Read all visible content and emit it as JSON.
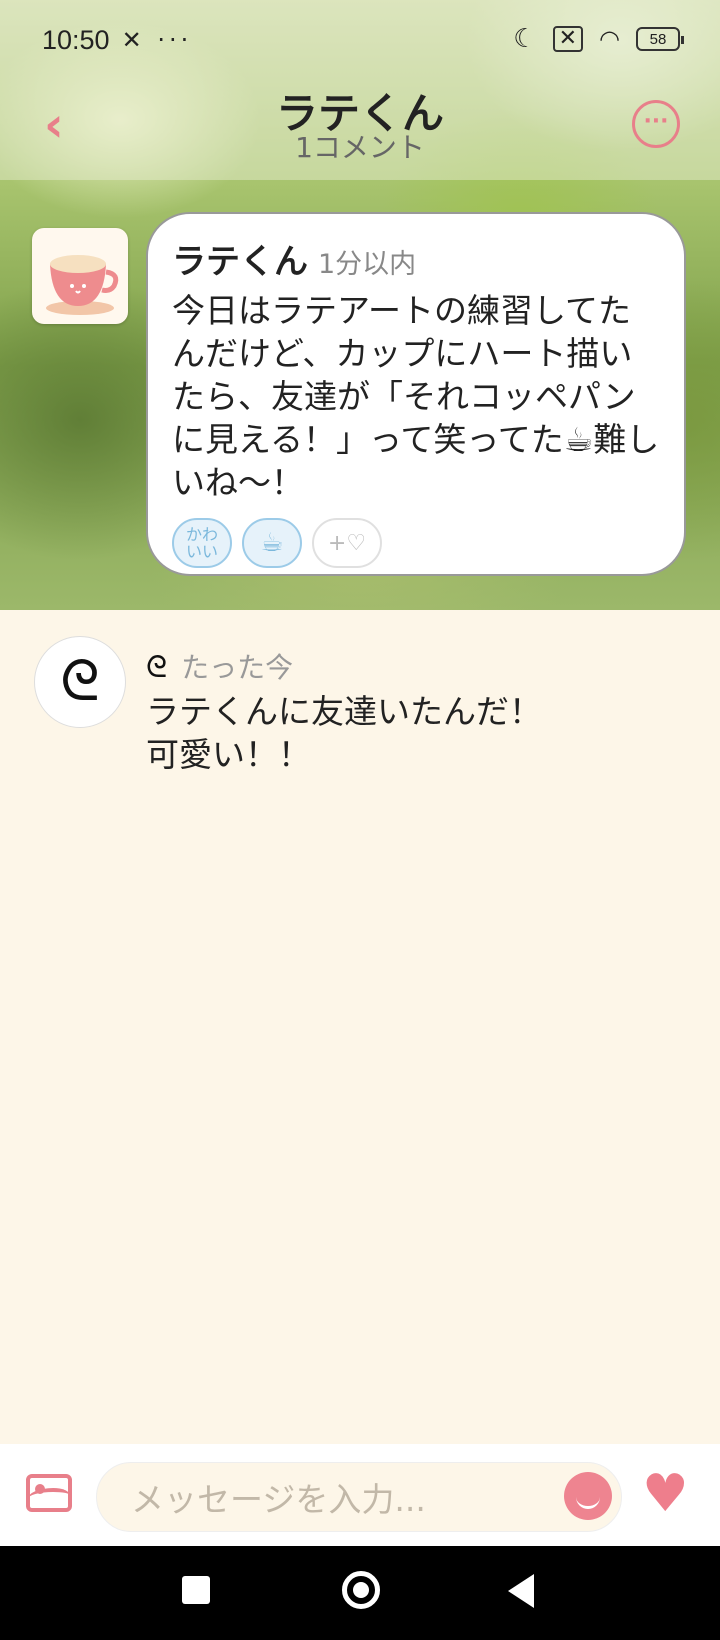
{
  "status_bar": {
    "time": "10:50",
    "left_icons": "✕ ···",
    "battery": "58"
  },
  "header": {
    "title": "ラテくん",
    "subtitle": "1コメント",
    "back_icon": "chevron-left-icon",
    "more_icon": "more-icon"
  },
  "post": {
    "author": "ラテくん",
    "time": "1分以内",
    "text": "今日はラテアートの練習してたんだけど、カップにハート描いたら、友達が「それコッペパンに見える！」って笑ってた☕難しいね〜！",
    "reactions": [
      {
        "label": "かわ\nいい"
      },
      {
        "label": "☕"
      },
      {
        "label": "+♡"
      }
    ]
  },
  "comment": {
    "avatar_text": "ᘓ",
    "author": "ᘓ",
    "time": "たった今",
    "text_line1": "ラテくんに友達いたんだ！",
    "text_line2": "可愛い！！"
  },
  "input": {
    "placeholder": "メッセージを入力..."
  },
  "colors": {
    "accent": "#e87f8a",
    "background": "#fdf6e8",
    "reaction_blue": "#9ccbe8"
  }
}
